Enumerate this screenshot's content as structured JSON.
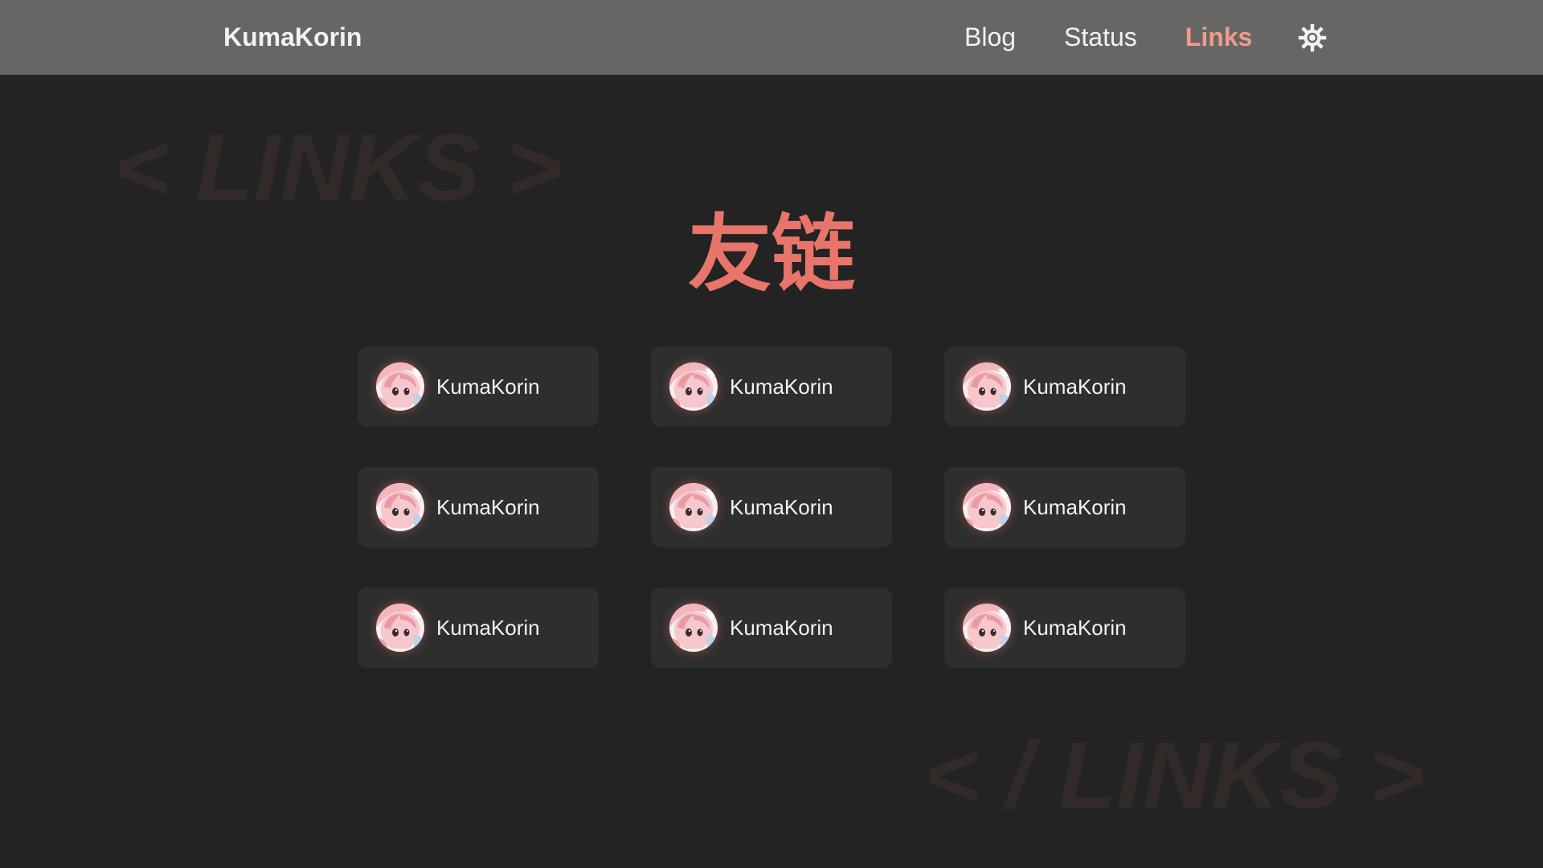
{
  "header": {
    "brand": "KumaKorin",
    "nav": [
      {
        "label": "Blog",
        "active": false
      },
      {
        "label": "Status",
        "active": false
      },
      {
        "label": "Links",
        "active": true
      }
    ],
    "theme_toggle_icon": "sun-icon"
  },
  "colors": {
    "accent": "#e8756a",
    "active_nav": "#f29a8e",
    "navbar_bg": "#666665",
    "page_bg": "#232323",
    "card_bg": "#2e2e2e"
  },
  "background_text": {
    "top": "< LINKS >",
    "bottom": "< / LINKS >"
  },
  "main": {
    "title": "友链",
    "links": [
      {
        "name": "KumaKorin",
        "avatar": "avatar-image"
      },
      {
        "name": "KumaKorin",
        "avatar": "avatar-image"
      },
      {
        "name": "KumaKorin",
        "avatar": "avatar-image"
      },
      {
        "name": "KumaKorin",
        "avatar": "avatar-image"
      },
      {
        "name": "KumaKorin",
        "avatar": "avatar-image"
      },
      {
        "name": "KumaKorin",
        "avatar": "avatar-image"
      },
      {
        "name": "KumaKorin",
        "avatar": "avatar-image"
      },
      {
        "name": "KumaKorin",
        "avatar": "avatar-image"
      },
      {
        "name": "KumaKorin",
        "avatar": "avatar-image"
      }
    ]
  }
}
